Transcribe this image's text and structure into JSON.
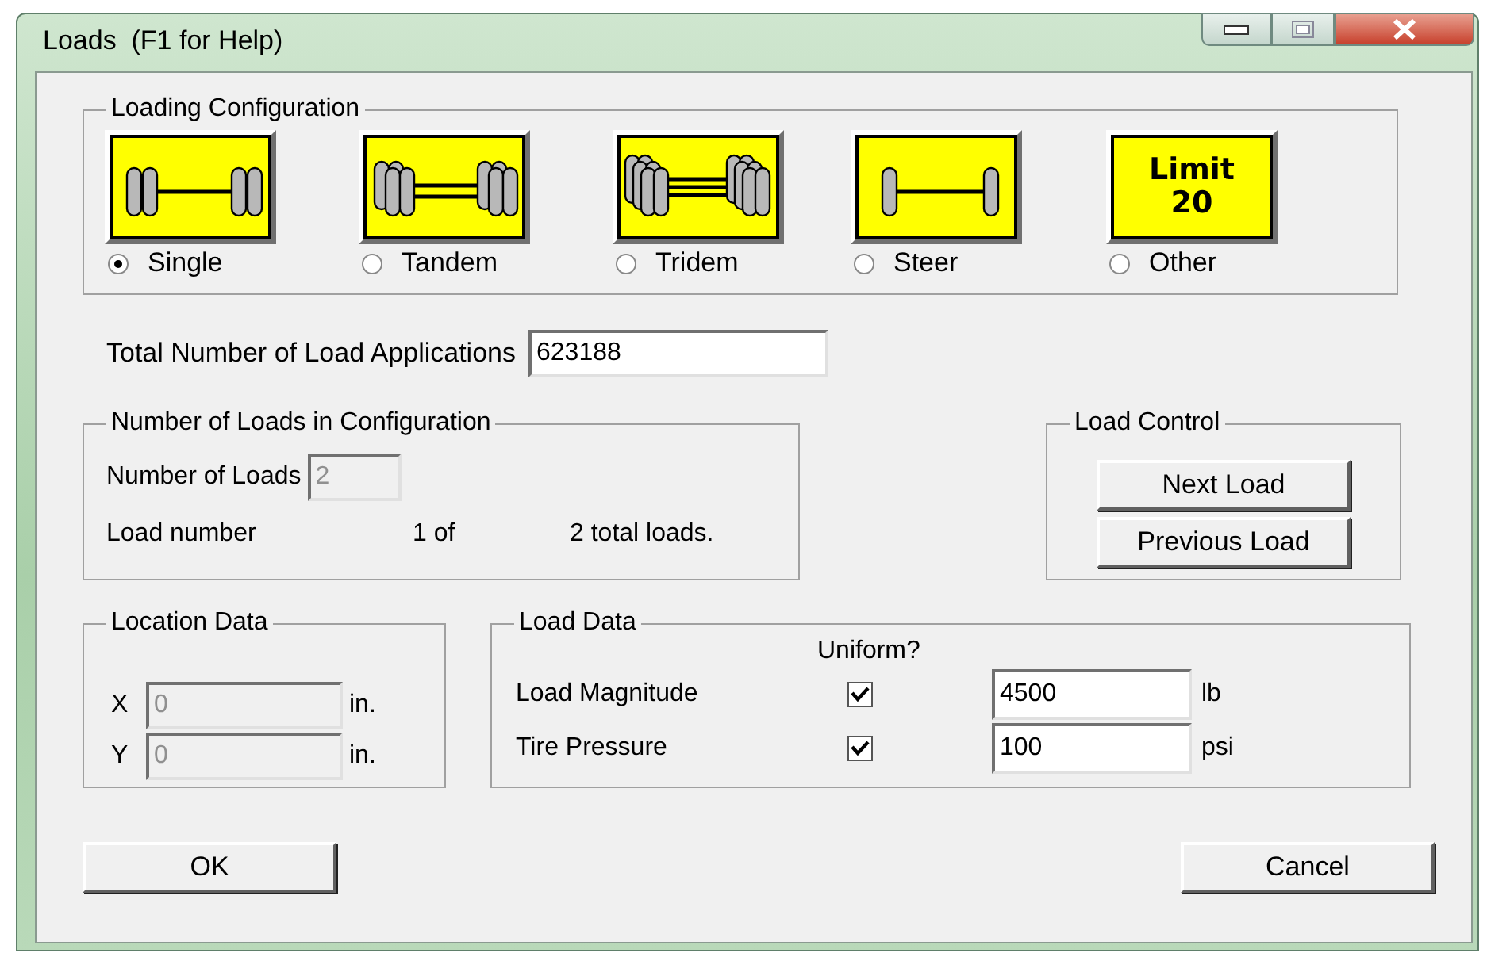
{
  "window": {
    "title": "Loads  (F1 for Help)"
  },
  "loading_configuration": {
    "title": "Loading Configuration",
    "options": [
      {
        "label": "Single",
        "kind": "single",
        "selected": true
      },
      {
        "label": "Tandem",
        "kind": "tandem",
        "selected": false
      },
      {
        "label": "Tridem",
        "kind": "tridem",
        "selected": false
      },
      {
        "label": "Steer",
        "kind": "steer",
        "selected": false
      },
      {
        "label": "Other",
        "kind": "limit",
        "icon_text": [
          "Limit",
          "20"
        ],
        "selected": false
      }
    ]
  },
  "total_applications": {
    "label": "Total Number of Load Applications",
    "value": "623188"
  },
  "loads_in_configuration": {
    "title": "Number of Loads in Configuration",
    "count_label": "Number of Loads",
    "count_value": "2",
    "count_disabled": true,
    "load_number_label": "Load number",
    "load_index": "1 of",
    "total": "2 total loads."
  },
  "load_control": {
    "title": "Load Control",
    "buttons": [
      "Next Load",
      "Previous Load"
    ]
  },
  "location_data": {
    "title": "Location Data",
    "fields": [
      {
        "label": "X",
        "value": "0",
        "unit": "in.",
        "disabled": true
      },
      {
        "label": "Y",
        "value": "0",
        "unit": "in.",
        "disabled": true
      }
    ]
  },
  "load_data": {
    "title": "Load Data",
    "uniform_header": "Uniform?",
    "rows": [
      {
        "label": "Load Magnitude",
        "uniform": true,
        "value": "4500",
        "unit": "lb"
      },
      {
        "label": "Tire Pressure",
        "uniform": true,
        "value": "100",
        "unit": "psi"
      }
    ]
  },
  "buttons": [
    "OK",
    "Cancel"
  ]
}
